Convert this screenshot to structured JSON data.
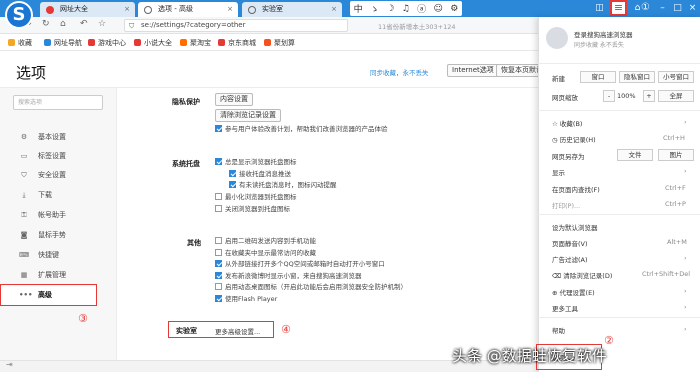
{
  "tabs": {
    "tab1": "网址大全",
    "tab2": "选项 - 高级",
    "tab3": "实验室"
  },
  "ime": [
    "中",
    "ゝ",
    "☽",
    "♫",
    "ⓐ",
    "☺",
    "⚙"
  ],
  "address": {
    "url": "se://settings/?category=other",
    "hint": "11省份新增本土303+124"
  },
  "bookmarks": [
    "收藏",
    "网址导航",
    "游戏中心",
    "小说大全",
    "聚淘宝",
    "京东商城",
    "聚划算"
  ],
  "page": {
    "title": "选项",
    "sync_link": "同步收藏，永不丢失",
    "internet_options": "Internet选项",
    "restore_defaults": "恢复本页默认"
  },
  "sidebar": {
    "search_placeholder": "搜索选项",
    "items": [
      "基本设置",
      "标签设置",
      "安全设置",
      "下载",
      "帐号助手",
      "鼠标手势",
      "快捷键",
      "扩展管理",
      "高级"
    ]
  },
  "privacy": {
    "label": "隐私保护",
    "content_settings": "内容设置",
    "clear_history": "清除浏览记录设置",
    "ux_plan": "参与用户体验改善计划，帮助我们改善浏览器的产品体验"
  },
  "tray": {
    "label": "系统托盘",
    "options": [
      "总是显示浏览器托盘图标",
      "接收托盘消息推送",
      "有未读托盘消息时，图标闪动提醒",
      "最小化浏览器到托盘图标",
      "关闭浏览器到托盘图标"
    ]
  },
  "other": {
    "label": "其他",
    "options": [
      "启用二维码发送内容到手机功能",
      "在收藏夹中显示最常访问的收藏",
      "从外部链接打开多个QQ空间或邮箱时自动打开小号窗口",
      "发布新浪微博时显示小窗，来自搜狗高速浏览器",
      "启用动态桌面图标（开启此功能后会启用浏览器安全防护机制）",
      "使用Flash Player"
    ]
  },
  "lab": {
    "label": "实验室",
    "more": "更多高级设置..."
  },
  "annotations": [
    "①",
    "②",
    "③",
    "④"
  ],
  "menu": {
    "login_title": "登录搜狗高速浏览器",
    "login_sub": "同步收藏 永不丢失",
    "new_label": "新建",
    "new_window": "窗口",
    "incognito": "隐私窗口",
    "small_window": "小号窗口",
    "zoom_label": "网页缩放",
    "zoom_minus": "-",
    "zoom_value": "100%",
    "zoom_plus": "+",
    "fullscreen": "全屏",
    "favorites": "收藏(B)",
    "history": "历史记录(H)",
    "history_key": "Ctrl+H",
    "save_as": "网页另存为",
    "save_file": "文件",
    "save_image": "图片",
    "display": "显示",
    "find": "在页面内查找(F)",
    "find_key": "Ctrl+F",
    "print": "打印(P)...",
    "print_key": "Ctrl+P",
    "default_browser": "设为默认浏览器",
    "mute": "页面静音(V)",
    "mute_key": "Alt+M",
    "adblock": "广告过滤(A)",
    "clear": "清除浏览记录(D)",
    "clear_key": "Ctrl+Shift+Del",
    "proxy": "代理设置(E)",
    "more_tools": "更多工具",
    "help": "帮助",
    "options": "选项(O)"
  },
  "watermark": "头条 @数据蛙恢复软件",
  "colors": {
    "tabbar": "#2b88d8",
    "highlight": "#e53935",
    "accent": "#2b88d8"
  }
}
